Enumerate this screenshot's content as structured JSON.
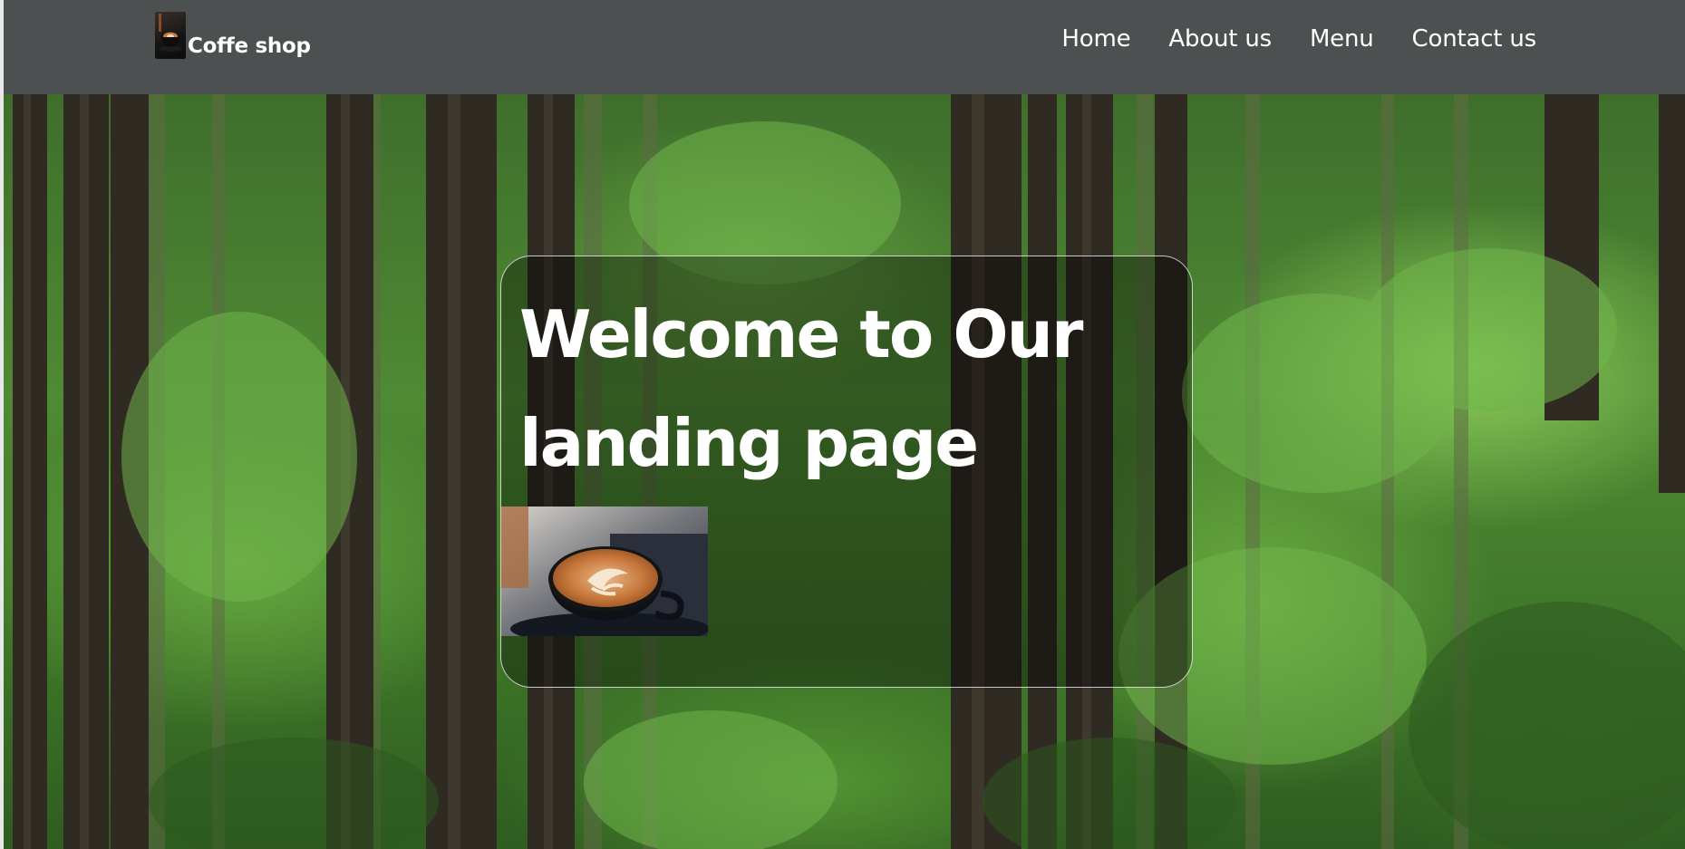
{
  "header": {
    "brand_name": "Coffe shop",
    "logo_icon": "coffee-cup-logo",
    "background": "#4d5050"
  },
  "nav": {
    "items": [
      {
        "label": "Home"
      },
      {
        "label": "About us"
      },
      {
        "label": "Menu"
      },
      {
        "label": "Contact us"
      }
    ]
  },
  "hero": {
    "background": "forest-photo",
    "title_line_1": "Welcome to Our",
    "title_line_2": "landing page",
    "image": "latte-art-coffee-cup"
  }
}
